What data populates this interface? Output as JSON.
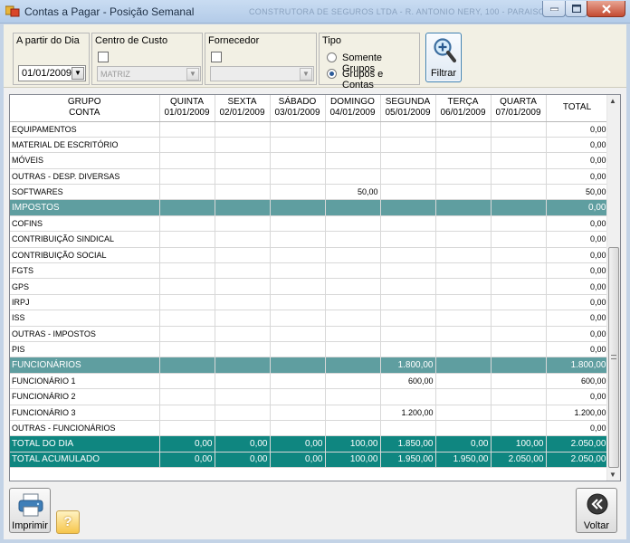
{
  "window": {
    "title": "Contas a Pagar - Posição Semanal",
    "ghost_title": "CONSTRUTORA DE SEGUROS LTDA - R. ANTONIO NERY, 100 - PARAISO"
  },
  "filters": {
    "date": {
      "label": "A partir do Dia",
      "value": "01/01/2009"
    },
    "cost_center": {
      "label": "Centro de Custo",
      "value": "MATRIZ"
    },
    "supplier": {
      "label": "Fornecedor",
      "value": ""
    },
    "type": {
      "label": "Tipo",
      "options": [
        "Somente Grupos",
        "Grupos e Contas"
      ],
      "selected": "Grupos e Contas"
    },
    "filter_button": "Filtrar"
  },
  "grid": {
    "header": {
      "name": [
        "GRUPO",
        "CONTA"
      ],
      "days": [
        {
          "day": "QUINTA",
          "date": "01/01/2009"
        },
        {
          "day": "SEXTA",
          "date": "02/01/2009"
        },
        {
          "day": "SÁBADO",
          "date": "03/01/2009"
        },
        {
          "day": "DOMINGO",
          "date": "04/01/2009"
        },
        {
          "day": "SEGUNDA",
          "date": "05/01/2009"
        },
        {
          "day": "TERÇA",
          "date": "06/01/2009"
        },
        {
          "day": "QUARTA",
          "date": "07/01/2009"
        }
      ],
      "total": "TOTAL"
    },
    "rows": [
      {
        "kind": "account",
        "name": "EQUIPAMENTOS",
        "values": [
          "",
          "",
          "",
          "",
          "",
          "",
          ""
        ],
        "total": "0,00"
      },
      {
        "kind": "account",
        "name": "MATERIAL DE ESCRITÓRIO",
        "values": [
          "",
          "",
          "",
          "",
          "",
          "",
          ""
        ],
        "total": "0,00"
      },
      {
        "kind": "account",
        "name": "MÓVEIS",
        "values": [
          "",
          "",
          "",
          "",
          "",
          "",
          ""
        ],
        "total": "0,00"
      },
      {
        "kind": "account",
        "name": "OUTRAS - DESP. DIVERSAS",
        "values": [
          "",
          "",
          "",
          "",
          "",
          "",
          ""
        ],
        "total": "0,00"
      },
      {
        "kind": "account",
        "name": "SOFTWARES",
        "values": [
          "",
          "",
          "",
          "50,00",
          "",
          "",
          ""
        ],
        "total": "50,00"
      },
      {
        "kind": "group",
        "name": "IMPOSTOS",
        "values": [
          "",
          "",
          "",
          "",
          "",
          "",
          ""
        ],
        "total": "0,00"
      },
      {
        "kind": "account",
        "name": "COFINS",
        "values": [
          "",
          "",
          "",
          "",
          "",
          "",
          ""
        ],
        "total": "0,00"
      },
      {
        "kind": "account",
        "name": "CONTRIBUIÇÃO SINDICAL",
        "values": [
          "",
          "",
          "",
          "",
          "",
          "",
          ""
        ],
        "total": "0,00"
      },
      {
        "kind": "account",
        "name": "CONTRIBUIÇÃO SOCIAL",
        "values": [
          "",
          "",
          "",
          "",
          "",
          "",
          ""
        ],
        "total": "0,00"
      },
      {
        "kind": "account",
        "name": "FGTS",
        "values": [
          "",
          "",
          "",
          "",
          "",
          "",
          ""
        ],
        "total": "0,00"
      },
      {
        "kind": "account",
        "name": "GPS",
        "values": [
          "",
          "",
          "",
          "",
          "",
          "",
          ""
        ],
        "total": "0,00"
      },
      {
        "kind": "account",
        "name": "IRPJ",
        "values": [
          "",
          "",
          "",
          "",
          "",
          "",
          ""
        ],
        "total": "0,00"
      },
      {
        "kind": "account",
        "name": "ISS",
        "values": [
          "",
          "",
          "",
          "",
          "",
          "",
          ""
        ],
        "total": "0,00"
      },
      {
        "kind": "account",
        "name": "OUTRAS - IMPOSTOS",
        "values": [
          "",
          "",
          "",
          "",
          "",
          "",
          ""
        ],
        "total": "0,00"
      },
      {
        "kind": "account",
        "name": "PIS",
        "values": [
          "",
          "",
          "",
          "",
          "",
          "",
          ""
        ],
        "total": "0,00"
      },
      {
        "kind": "group",
        "name": "FUNCIONÁRIOS",
        "values": [
          "",
          "",
          "",
          "",
          "1.800,00",
          "",
          ""
        ],
        "total": "1.800,00"
      },
      {
        "kind": "account",
        "name": "FUNCIONÁRIO 1",
        "values": [
          "",
          "",
          "",
          "",
          "600,00",
          "",
          ""
        ],
        "total": "600,00"
      },
      {
        "kind": "account",
        "name": "FUNCIONÁRIO 2",
        "values": [
          "",
          "",
          "",
          "",
          "",
          "",
          ""
        ],
        "total": "0,00"
      },
      {
        "kind": "account",
        "name": "FUNCIONÁRIO 3",
        "values": [
          "",
          "",
          "",
          "",
          "1.200,00",
          "",
          ""
        ],
        "total": "1.200,00"
      },
      {
        "kind": "account",
        "name": "OUTRAS - FUNCIONÁRIOS",
        "values": [
          "",
          "",
          "",
          "",
          "",
          "",
          ""
        ],
        "total": "0,00"
      },
      {
        "kind": "total",
        "name": "TOTAL DO DIA",
        "values": [
          "0,00",
          "0,00",
          "0,00",
          "100,00",
          "1.850,00",
          "0,00",
          "100,00"
        ],
        "total": "2.050,00"
      },
      {
        "kind": "total",
        "name": "TOTAL ACUMULADO",
        "values": [
          "0,00",
          "0,00",
          "0,00",
          "100,00",
          "1.950,00",
          "1.950,00",
          "2.050,00"
        ],
        "total": "2.050,00"
      }
    ]
  },
  "footer": {
    "print_button": "Imprimir",
    "help_button": "?",
    "back_button": "Voltar"
  },
  "colors": {
    "group_row": "#5f9ea0",
    "total_row": "#0f8680",
    "window_frame": "#c3d3e6"
  },
  "icons": {
    "app": "app-icon",
    "filter": "magnifier-plus-icon",
    "print": "printer-icon",
    "help": "question-icon",
    "back": "double-chevron-left-icon"
  }
}
